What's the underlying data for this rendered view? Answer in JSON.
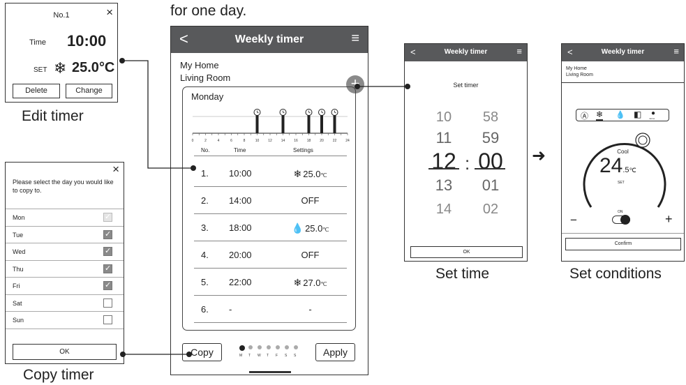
{
  "header_text": "for one day.",
  "edit_timer": {
    "caption": "Edit timer",
    "no": "No.1",
    "time_label": "Time",
    "time_value": "10:00",
    "set_label": "SET",
    "set_value": "25.0",
    "set_unit": "°C",
    "delete_label": "Delete",
    "change_label": "Change",
    "close": "×"
  },
  "copy_timer": {
    "caption": "Copy timer",
    "close": "×",
    "prompt": "Please select the day you would like to copy to.",
    "days": [
      {
        "label": "Mon",
        "state": "disabled"
      },
      {
        "label": "Tue",
        "state": "checked"
      },
      {
        "label": "Wed",
        "state": "checked"
      },
      {
        "label": "Thu",
        "state": "checked"
      },
      {
        "label": "Fri",
        "state": "checked"
      },
      {
        "label": "Sat",
        "state": "unchecked"
      },
      {
        "label": "Sun",
        "state": "unchecked"
      }
    ],
    "ok_label": "OK"
  },
  "weekly": {
    "title": "Weekly timer",
    "home": "My Home",
    "room": "Living Room",
    "day": "Monday",
    "axis_ticks": [
      "0",
      "2",
      "4",
      "6",
      "8",
      "10",
      "12",
      "14",
      "16",
      "18",
      "20",
      "22",
      "24"
    ],
    "timer_hours": [
      10,
      14,
      18,
      20,
      22
    ],
    "col_no": "No.",
    "col_time": "Time",
    "col_settings": "Settings",
    "rows": [
      {
        "no": "1.",
        "time": "10:00",
        "setting": "25.0",
        "unit": "℃",
        "icon": "snowflake-icon"
      },
      {
        "no": "2.",
        "time": "14:00",
        "setting": "OFF",
        "unit": "",
        "icon": ""
      },
      {
        "no": "3.",
        "time": "18:00",
        "setting": "25.0",
        "unit": "℃",
        "icon": "drop-icon"
      },
      {
        "no": "4.",
        "time": "20:00",
        "setting": "OFF",
        "unit": "",
        "icon": ""
      },
      {
        "no": "5.",
        "time": "22:00",
        "setting": "27.0",
        "unit": "℃",
        "icon": "snowflake-icon"
      },
      {
        "no": "6.",
        "time": "-",
        "setting": "-",
        "unit": "",
        "icon": ""
      }
    ],
    "copy_label": "Copy",
    "apply_label": "Apply",
    "week_letters": [
      "M",
      "T",
      "W",
      "T",
      "F",
      "S",
      "S"
    ],
    "active_day_index": 0,
    "plus": "+"
  },
  "set_time": {
    "caption": "Set time",
    "title": "Weekly timer",
    "heading": "Set timer",
    "hours": [
      "10",
      "11",
      "12",
      "13",
      "14"
    ],
    "minutes": [
      "58",
      "59",
      "00",
      "01",
      "02"
    ],
    "colon": ":",
    "ok_label": "OK"
  },
  "set_conditions": {
    "caption": "Set conditions",
    "title": "Weekly timer",
    "home": "My Home",
    "room": "Living Room",
    "mode": "Cool",
    "temp_main": "24",
    "temp_dec": ".5",
    "temp_unit": "℃",
    "set_label": "SET",
    "minus": "−",
    "plus": "+",
    "power_label": "ON",
    "confirm_label": "Confirm",
    "nanoe_label": "nanoe"
  }
}
